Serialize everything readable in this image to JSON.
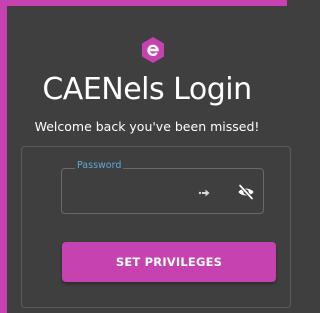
{
  "app": {
    "title": "CAENels Login",
    "subtitle": "Welcome back you've been missed!",
    "logo_icon": "caenels-logo-icon",
    "accent_color": "#c542b0",
    "background_color": "#403f3f"
  },
  "form": {
    "password": {
      "label": "Password",
      "value": "",
      "icons": [
        "keypass-arrow-icon",
        "eye-off-icon"
      ],
      "label_color": "#5fa9d8"
    },
    "submit_label": "SET PRIVILEGES"
  }
}
